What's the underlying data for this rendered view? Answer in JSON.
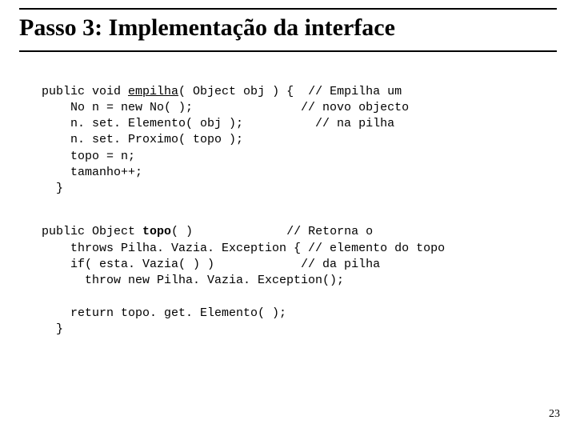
{
  "title": "Passo 3:  Implementação da interface",
  "code1": {
    "sig_pre": "public void ",
    "sig_name": "empilha",
    "sig_post": "( Object obj ) {  // Empilha um",
    "l2": "    No n = new No( );               // novo objecto",
    "l3": "    n. set. Elemento( obj );          // na pilha",
    "l4": "    n. set. Proximo( topo );",
    "l5": "    topo = n;",
    "l6": "    tamanho++;",
    "l7": "  }"
  },
  "code2": {
    "sig_pre": "public Object ",
    "sig_name": "topo",
    "sig_post": "( )             // Retorna o",
    "l2": "    throws Pilha. Vazia. Exception { // elemento do topo",
    "l3": "    if( esta. Vazia( ) )            // da pilha",
    "l4": "      throw new Pilha. Vazia. Exception();",
    "l5": "",
    "l6": "    return topo. get. Elemento( );",
    "l7": "  }"
  },
  "page_number": "23"
}
